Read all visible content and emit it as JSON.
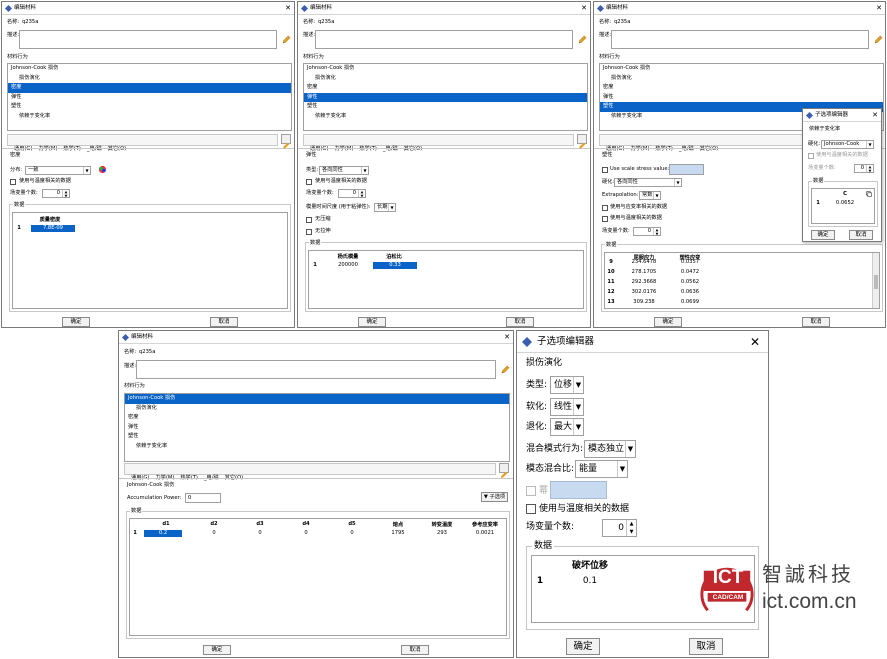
{
  "common": {
    "title": "编辑材料",
    "name_label": "名称:",
    "name_value": "q235a",
    "desc_label": "描述:",
    "behavior_label": "材料行为",
    "behaviors": [
      "Johnson-Cook 损伤",
      "损伤演化",
      "密度",
      "弹性",
      "塑性",
      "依赖于变化率"
    ],
    "menus": [
      "通用(G)",
      "力学(M)",
      "热学(T)",
      "_电/磁",
      "其它(O)"
    ],
    "ok": "确定",
    "cancel": "取消",
    "close": "✕"
  },
  "win1": {
    "section": "密度",
    "dist_label": "分布:",
    "dist_value": "一致",
    "temp_check": "使用与温度相关的数据",
    "field_label": "场变量个数:",
    "field_value": "0",
    "data_label": "数据",
    "col": "质量密度",
    "row": "1",
    "val": "7.8E-09"
  },
  "win2": {
    "section": "弹性",
    "type_label": "类型:",
    "type_value": "各向同性",
    "temp_check": "使用与温度相关的数据",
    "field_label": "场变量个数:",
    "field_value": "0",
    "modulus_label": "模量时间尺度 (用于粘弹性):",
    "modulus_value": "长期",
    "no_compress": "无压缩",
    "no_tension": "无拉伸",
    "data_label": "数据",
    "cols": [
      "杨氏模量",
      "泊松比"
    ],
    "row": "1",
    "vals": [
      "200000",
      "0.33"
    ]
  },
  "win3": {
    "section": "塑性",
    "scale_check": "Use scale stress value:",
    "hard_label": "硬化:",
    "hard_value": "各向同性",
    "extra_label": "Extrapolation:",
    "extra_value": "常数",
    "rate_check": "使用与应变率相关的数据",
    "temp_check": "使用与温度相关的数据",
    "field_label": "场变量个数:",
    "field_value": "0",
    "data_label": "数据",
    "cols": [
      "屈服应力",
      "塑性应变"
    ],
    "rows": [
      {
        "n": "9",
        "a": "234.6478",
        "b": "0.0357"
      },
      {
        "n": "10",
        "a": "278.1705",
        "b": "0.0472"
      },
      {
        "n": "11",
        "a": "292.3668",
        "b": "0.0562"
      },
      {
        "n": "12",
        "a": "302.0176",
        "b": "0.0636"
      },
      {
        "n": "13",
        "a": "309.238",
        "b": "0.0699"
      }
    ]
  },
  "sub_small": {
    "title": "子选项编辑器",
    "section": "依赖于变化率",
    "hard_label": "硬化:",
    "hard_value": "Johnson-Cook",
    "temp_check": "使用与温度相关的数据",
    "field_label": "场变量个数:",
    "field_value": "0",
    "data_label": "数据",
    "col": "C",
    "row": "1",
    "val": "0.0652",
    "ok": "确定",
    "cancel": "取消"
  },
  "win4": {
    "section": "Johnson-Cook 损伤",
    "accum_label": "Accumulation Power:",
    "accum_value": "0",
    "suboption": "▼ 子选项",
    "data_label": "数据",
    "cols": [
      "d1",
      "d2",
      "d3",
      "d4",
      "d5",
      "熔点",
      "转变温度",
      "参考应变率"
    ],
    "row": "1",
    "vals": [
      "0.2",
      "0",
      "0",
      "0",
      "0",
      "1795",
      "293",
      "0.0021"
    ]
  },
  "sub_big": {
    "title": "子选项编辑器",
    "section": "损伤演化",
    "type_label": "类型:",
    "type_value": "位移",
    "soft_label": "软化:",
    "soft_value": "线性",
    "degr_label": "退化:",
    "degr_value": "最大",
    "mix_label": "混合模式行为:",
    "mix_value": "模态独立",
    "ratio_label": "模态混合比:",
    "ratio_value": "能量",
    "power_label": "幂",
    "temp_check": "使用与温度相关的数据",
    "field_label": "场变量个数:",
    "field_value": "0",
    "data_label": "数据",
    "col": "破坏位移",
    "row": "1",
    "val": "0.1",
    "ok": "确定",
    "cancel": "取消"
  },
  "logo": {
    "mark": "ICT",
    "mark_sub": "CAD/CAM",
    "cn": "智誠科技",
    "url": "ict.com.cn"
  }
}
